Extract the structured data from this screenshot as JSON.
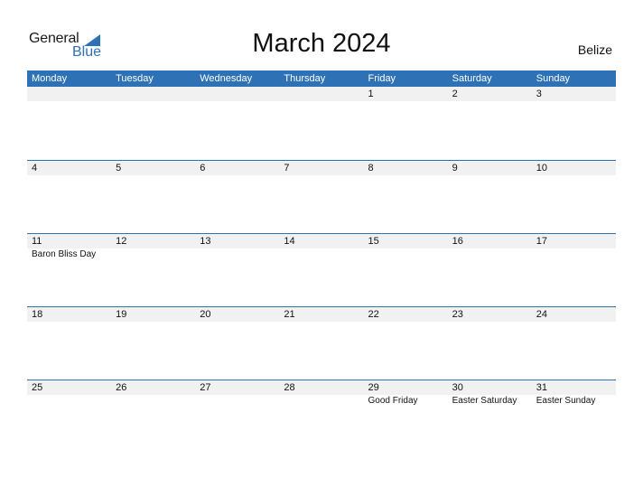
{
  "logo": {
    "word1": "General",
    "word2": "Blue",
    "color": "#2e72b5"
  },
  "title": "March 2024",
  "country": "Belize",
  "weekdays": [
    "Monday",
    "Tuesday",
    "Wednesday",
    "Thursday",
    "Friday",
    "Saturday",
    "Sunday"
  ],
  "weeks": [
    {
      "days": [
        {
          "num": "",
          "holiday": ""
        },
        {
          "num": "",
          "holiday": ""
        },
        {
          "num": "",
          "holiday": ""
        },
        {
          "num": "",
          "holiday": ""
        },
        {
          "num": "1",
          "holiday": ""
        },
        {
          "num": "2",
          "holiday": ""
        },
        {
          "num": "3",
          "holiday": ""
        }
      ]
    },
    {
      "days": [
        {
          "num": "4",
          "holiday": ""
        },
        {
          "num": "5",
          "holiday": ""
        },
        {
          "num": "6",
          "holiday": ""
        },
        {
          "num": "7",
          "holiday": ""
        },
        {
          "num": "8",
          "holiday": ""
        },
        {
          "num": "9",
          "holiday": ""
        },
        {
          "num": "10",
          "holiday": ""
        }
      ]
    },
    {
      "days": [
        {
          "num": "11",
          "holiday": "Baron Bliss Day"
        },
        {
          "num": "12",
          "holiday": ""
        },
        {
          "num": "13",
          "holiday": ""
        },
        {
          "num": "14",
          "holiday": ""
        },
        {
          "num": "15",
          "holiday": ""
        },
        {
          "num": "16",
          "holiday": ""
        },
        {
          "num": "17",
          "holiday": ""
        }
      ]
    },
    {
      "days": [
        {
          "num": "18",
          "holiday": ""
        },
        {
          "num": "19",
          "holiday": ""
        },
        {
          "num": "20",
          "holiday": ""
        },
        {
          "num": "21",
          "holiday": ""
        },
        {
          "num": "22",
          "holiday": ""
        },
        {
          "num": "23",
          "holiday": ""
        },
        {
          "num": "24",
          "holiday": ""
        }
      ]
    },
    {
      "days": [
        {
          "num": "25",
          "holiday": ""
        },
        {
          "num": "26",
          "holiday": ""
        },
        {
          "num": "27",
          "holiday": ""
        },
        {
          "num": "28",
          "holiday": ""
        },
        {
          "num": "29",
          "holiday": "Good Friday"
        },
        {
          "num": "30",
          "holiday": "Easter Saturday"
        },
        {
          "num": "31",
          "holiday": "Easter Sunday"
        }
      ]
    }
  ]
}
